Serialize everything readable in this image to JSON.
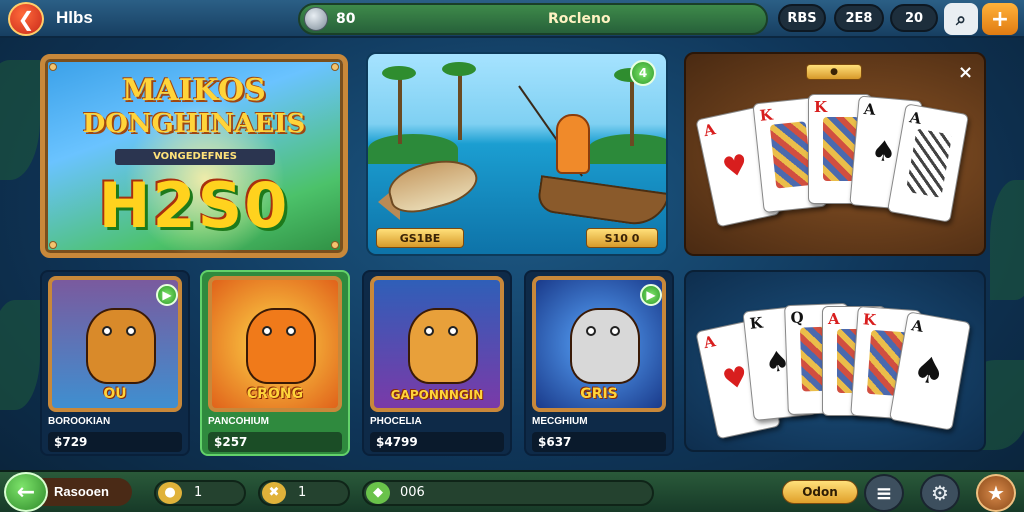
{
  "topbar": {
    "back_icon": "back-arrow-icon",
    "title": "Hlbs",
    "coins": "80",
    "center_title": "Rocleno",
    "pill_1": "RBS",
    "pill_2": "2E8",
    "pill_3": "20",
    "search_icon": "search-icon",
    "plus_icon": "plus-icon"
  },
  "banner": {
    "title_line1": "MAIKOS",
    "title_line2": "DONGHINAEIS",
    "subtitle": "VONGEDEFNES",
    "big_text": "H2S0"
  },
  "fishing": {
    "badge": "4",
    "tag_left": "GS1BE",
    "tag_right": "S10 0"
  },
  "cards_top": {
    "close": "×"
  },
  "tiles": [
    {
      "art_title": "OU",
      "name": "BOROOKIAN",
      "price": "$729"
    },
    {
      "art_title": "CRONG",
      "name": "PANCOHIUM",
      "price": "$257"
    },
    {
      "art_title": "GAPONNNGIN",
      "name": "PHOCELIA",
      "price": "$4799"
    },
    {
      "art_title": "GRIS",
      "name": "MECGHIUM",
      "price": "$637"
    }
  ],
  "bottombar": {
    "back_label": "Rasooen",
    "counter_1": "1",
    "counter_2": "1",
    "counter_3": "006",
    "gold_button": "Odon"
  },
  "colors": {
    "accent_green": "#3e8a4a",
    "accent_gold": "#ffd43a",
    "frame_wood": "#c8883a",
    "bg_blue": "#0f3558"
  }
}
